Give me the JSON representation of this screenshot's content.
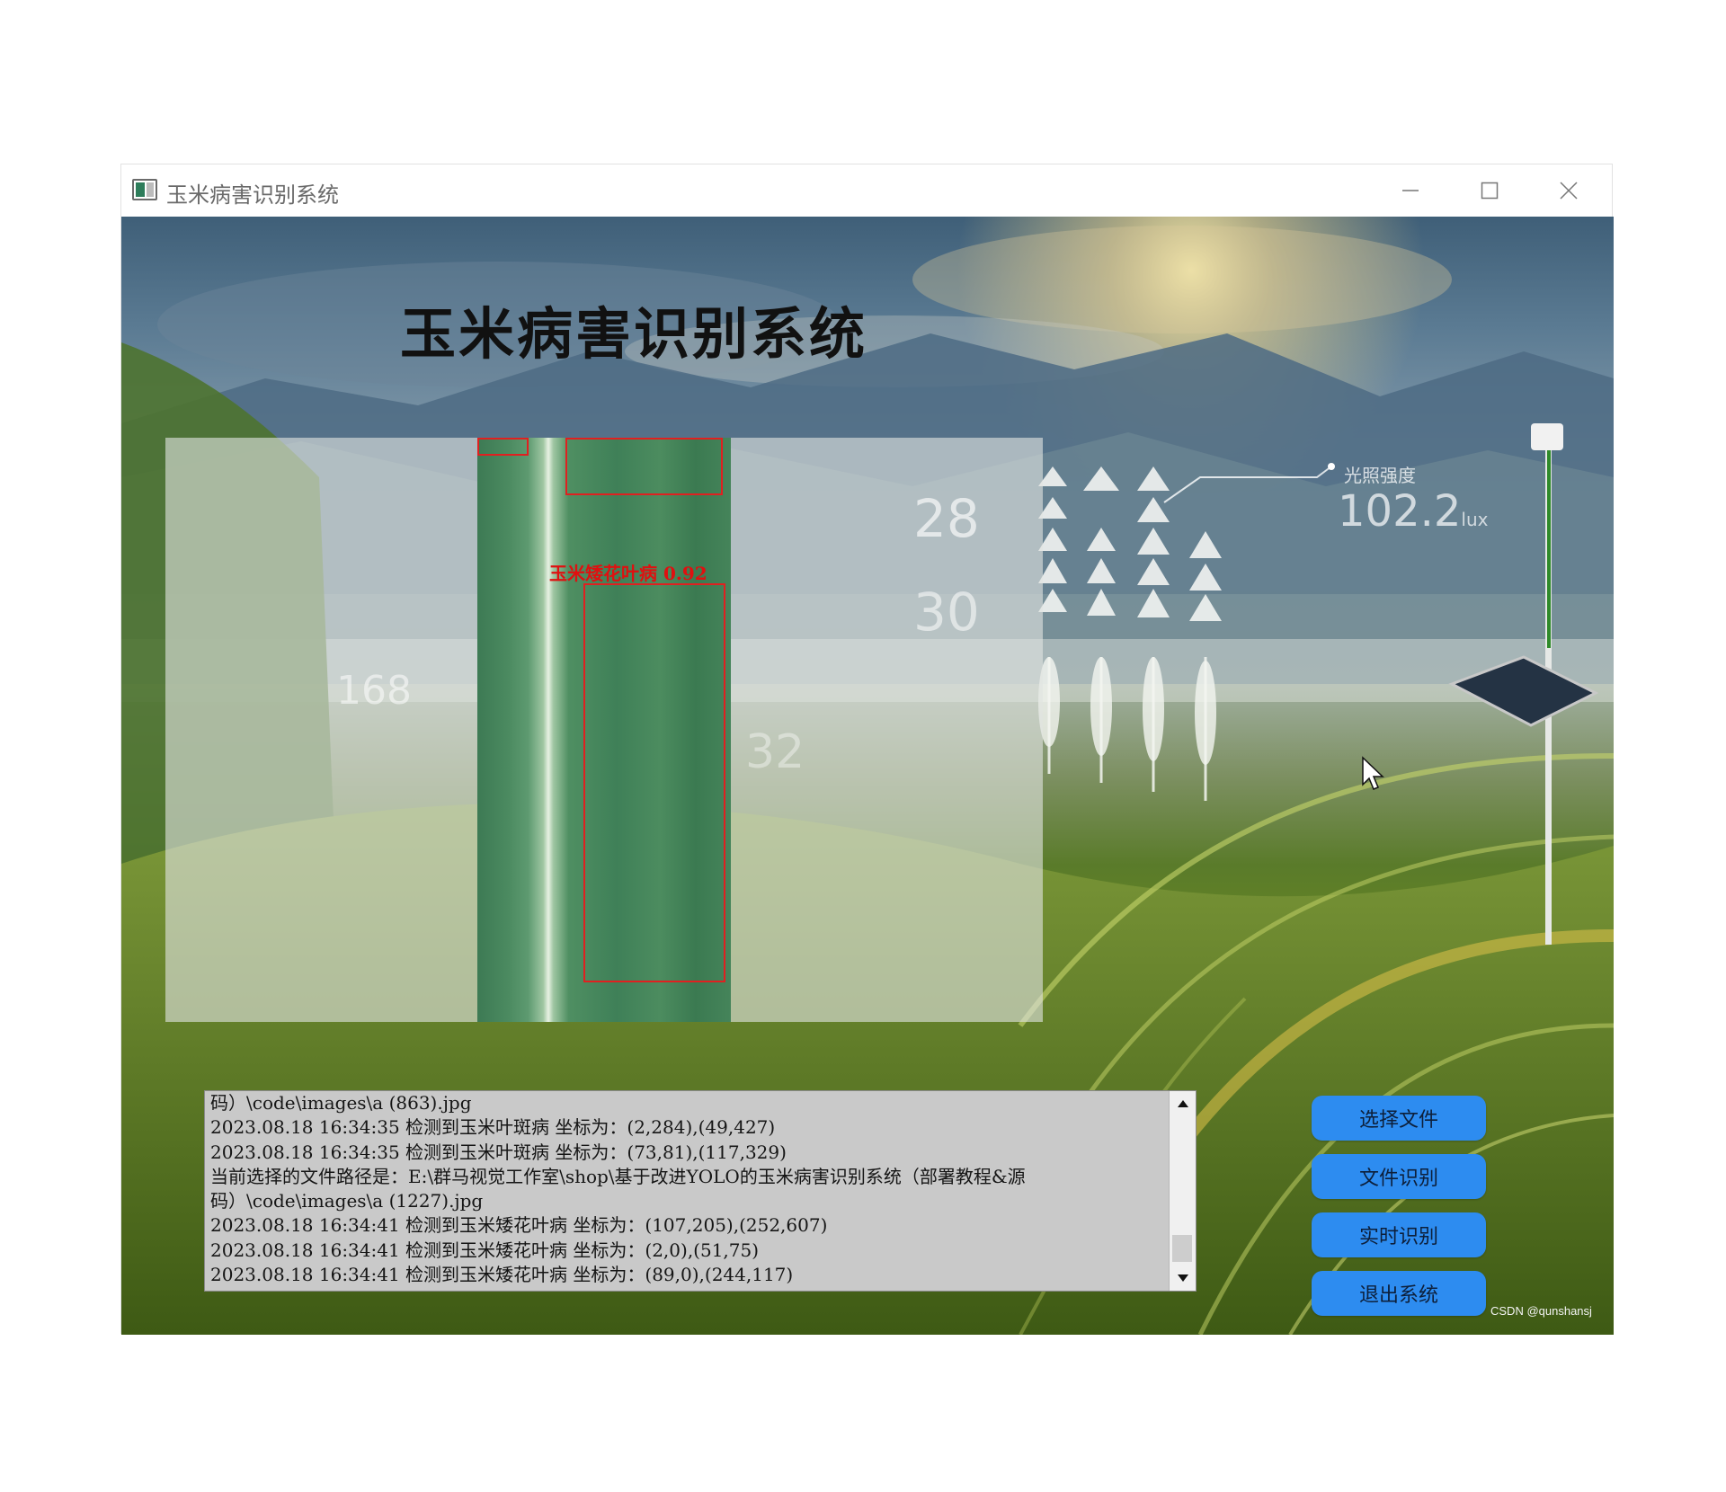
{
  "window": {
    "title": "玉米病害识别系统"
  },
  "app": {
    "heading": "玉米病害识别系统"
  },
  "background_overlay": {
    "temp_value_1": "28",
    "temp_value_2": "30",
    "lux_label": "光照强度",
    "lux_value": "102.2",
    "lux_unit": "lux",
    "left_value": "168",
    "middle_value": "32"
  },
  "detection": {
    "label": "玉米矮花叶病  0.92"
  },
  "log": {
    "lines": [
      "码）\\code\\images\\a (863).jpg",
      "2023.08.18 16:34:35 检测到玉米叶斑病 坐标为：(2,284),(49,427)",
      "2023.08.18 16:34:35 检测到玉米叶斑病 坐标为：(73,81),(117,329)",
      "当前选择的文件路径是：E:\\群马视觉工作室\\shop\\基于改进YOLO的玉米病害识别系统（部署教程&源",
      "码）\\code\\images\\a (1227).jpg",
      "2023.08.18 16:34:41 检测到玉米矮花叶病 坐标为：(107,205),(252,607)",
      "2023.08.18 16:34:41 检测到玉米矮花叶病 坐标为：(2,0),(51,75)",
      "2023.08.18 16:34:41 检测到玉米矮花叶病 坐标为：(89,0),(244,117)"
    ]
  },
  "buttons": {
    "select_file": "选择文件",
    "file_recognition": "文件识别",
    "realtime_recognition": "实时识别",
    "exit_system": "退出系统"
  },
  "watermark": "CSDN @qunshansj",
  "colors": {
    "button_blue": "#2d8cf0",
    "bbox_red": "#e02020",
    "log_bg": "#c9c9c9"
  }
}
